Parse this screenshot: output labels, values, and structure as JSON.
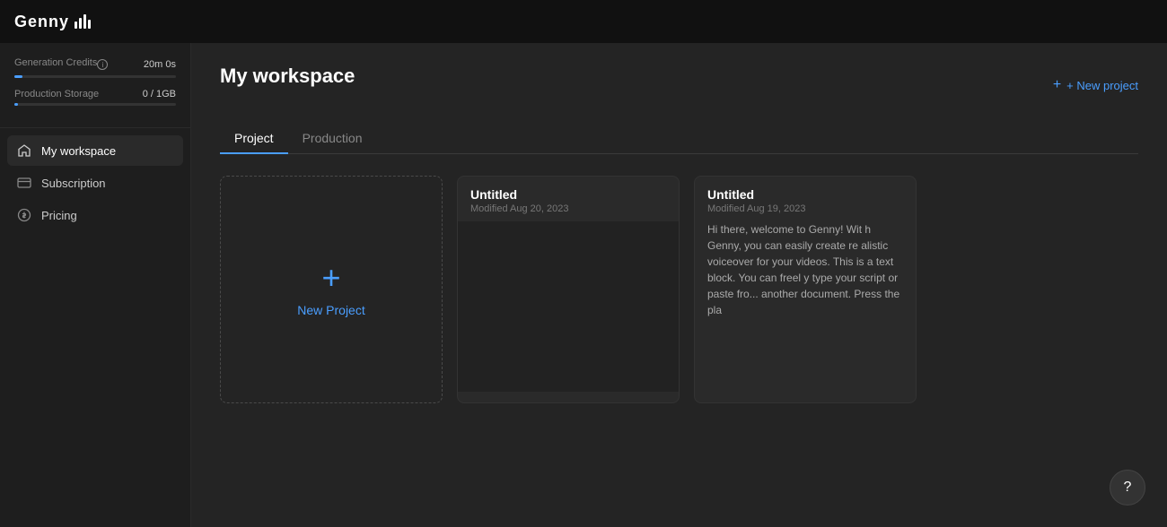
{
  "topbar": {
    "logo_text": "Genny"
  },
  "sidebar": {
    "credits_label": "Generation Credits",
    "credits_value": "20m 0s",
    "credits_percent": 5,
    "storage_label": "Production Storage",
    "storage_value": "0 / 1GB",
    "storage_percent": 2,
    "nav_items": [
      {
        "id": "workspace",
        "label": "My workspace",
        "active": true
      },
      {
        "id": "subscription",
        "label": "Subscription",
        "active": false
      },
      {
        "id": "pricing",
        "label": "Pricing",
        "active": false
      }
    ]
  },
  "main": {
    "title": "My workspace",
    "tabs": [
      {
        "id": "project",
        "label": "Project",
        "active": true
      },
      {
        "id": "production",
        "label": "Production",
        "active": false
      }
    ],
    "new_project_label": "New Project",
    "new_project_button": "+ New project",
    "projects": [
      {
        "id": 1,
        "title": "Untitled",
        "modified": "Modified Aug 20, 2023",
        "preview": ""
      },
      {
        "id": 2,
        "title": "Untitled",
        "modified": "Modified Aug 19, 2023",
        "body": "Hi there, welcome to Genny! Wit h Genny, you can easily create re alistic voiceover for your videos. This is a text block. You can freel y type your script or paste fro... another document. Press the pla"
      }
    ]
  },
  "help": {
    "label": "?"
  }
}
